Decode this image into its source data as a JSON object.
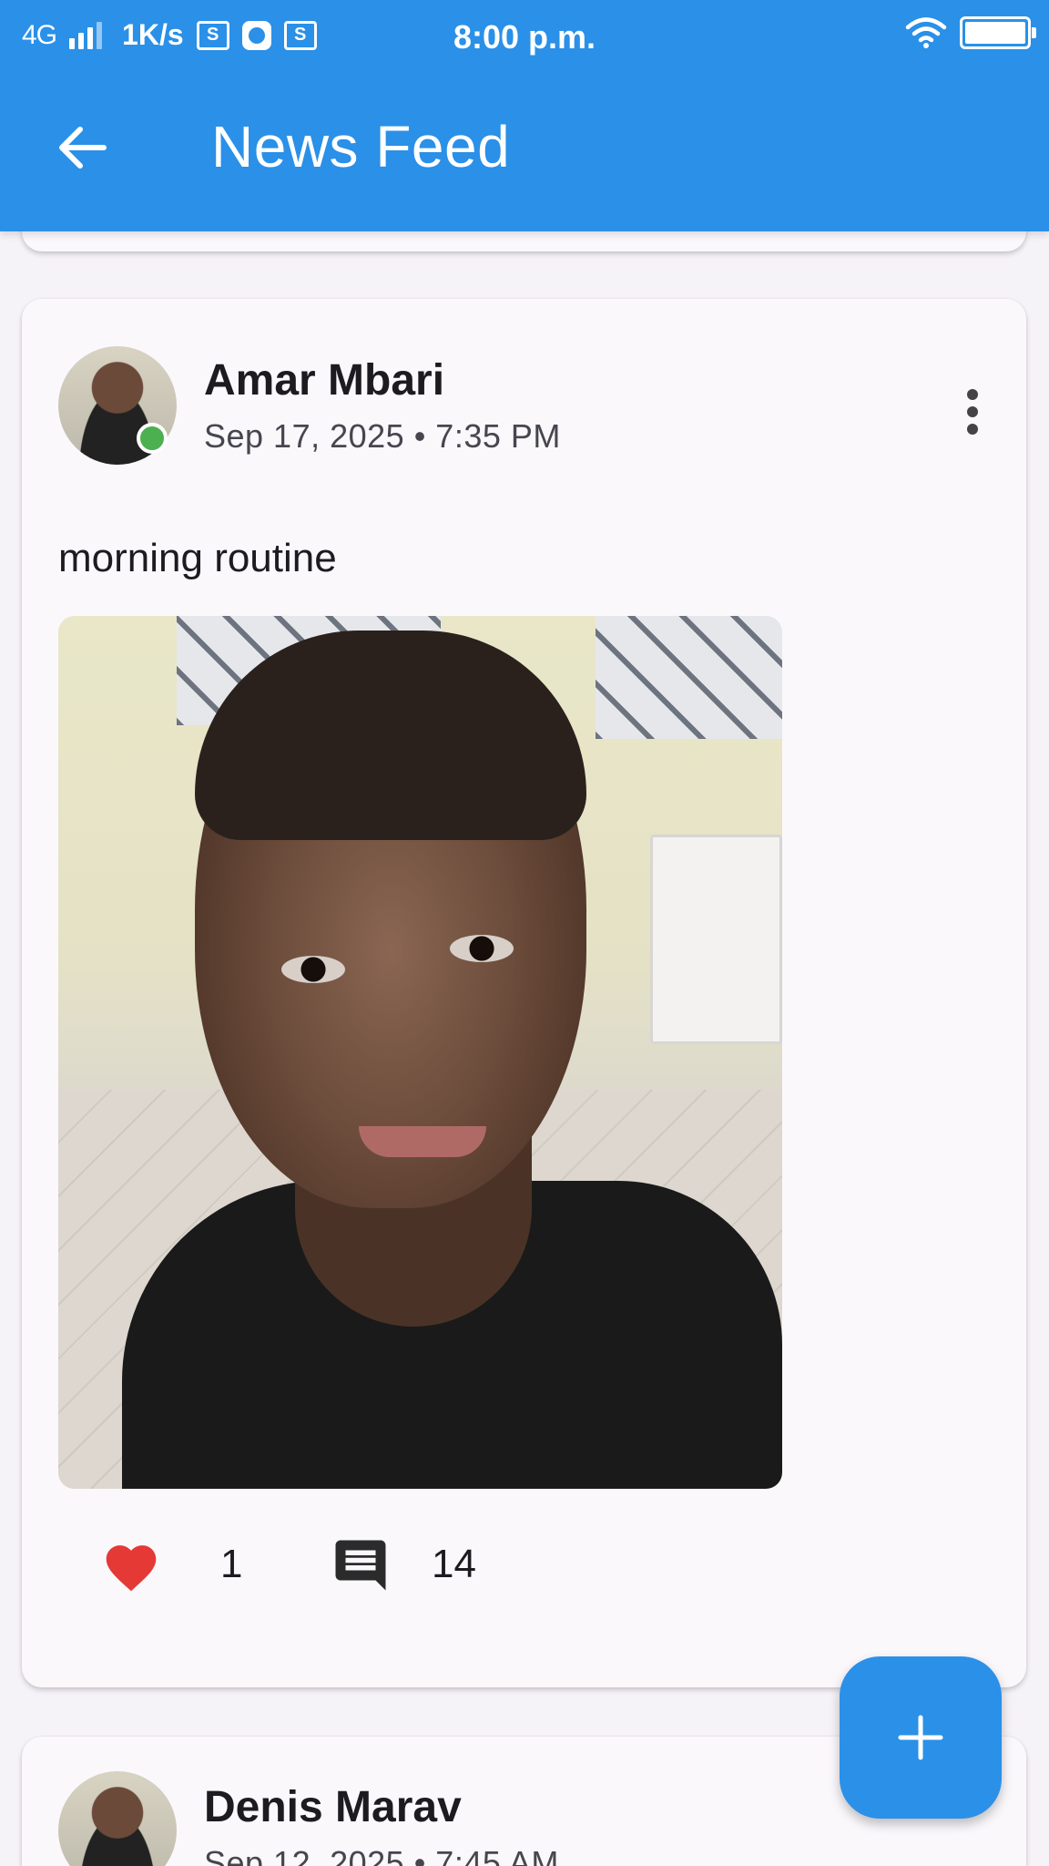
{
  "status_bar": {
    "network": "4G",
    "speed": "1K/s",
    "box1": "S",
    "box2": "S",
    "time": "8:00 p.m."
  },
  "app_bar": {
    "title": "News Feed",
    "back_icon": "arrow-back-icon"
  },
  "posts": [
    {
      "author": "Amar Mbari",
      "timestamp": "Sep 17, 2025 • 7:35 PM",
      "online": true,
      "text": "morning routine",
      "likes": "1",
      "comments": "14"
    },
    {
      "author": "Denis Marav",
      "timestamp": "Sep 12, 2025 • 7:45 AM",
      "online": false
    }
  ],
  "icons": {
    "like": "heart-icon",
    "comment": "comment-icon",
    "more": "more-vert-icon",
    "fab": "plus-icon"
  },
  "colors": {
    "primary": "#2a90e8",
    "like": "#e53935",
    "online": "#4caf50"
  }
}
